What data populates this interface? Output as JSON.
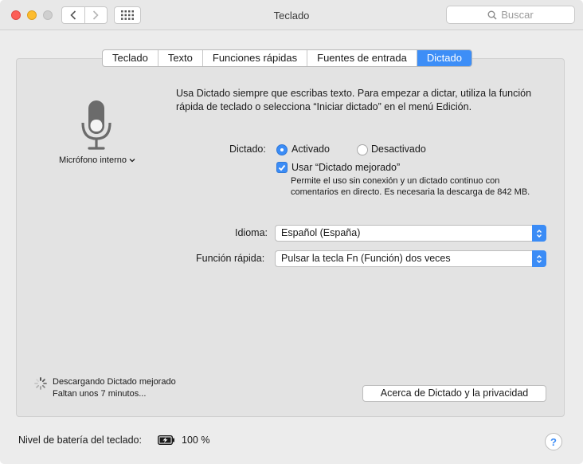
{
  "window": {
    "title": "Teclado",
    "search_placeholder": "Buscar"
  },
  "tabs": [
    {
      "label": "Teclado",
      "active": false
    },
    {
      "label": "Texto",
      "active": false
    },
    {
      "label": "Funciones rápidas",
      "active": false
    },
    {
      "label": "Fuentes de entrada",
      "active": false
    },
    {
      "label": "Dictado",
      "active": true
    }
  ],
  "mic": {
    "icon": "microphone-icon",
    "label": "Micrófono interno"
  },
  "dictation": {
    "intro": "Usa Dictado siempre que escribas texto. Para empezar a dictar, utiliza la función rápida de teclado o selecciona “Iniciar dictado” en el menú Edición.",
    "label": "Dictado:",
    "option_on": "Activado",
    "option_off": "Desactivado",
    "selected": "Activado",
    "enhanced_label": "Usar “Dictado mejorado”",
    "enhanced_checked": true,
    "enhanced_desc": "Permite el uso sin conexión y un dictado continuo con comentarios en directo. Es necesaria la descarga de 842 MB."
  },
  "language": {
    "label": "Idioma:",
    "value": "Español (España)"
  },
  "shortcut": {
    "label": "Función rápida:",
    "value": "Pulsar la tecla Fn (Función) dos veces"
  },
  "download": {
    "line1": "Descargando Dictado mejorado",
    "line2": "Faltan unos 7 minutos..."
  },
  "about_button": "Acerca de Dictado y la privacidad",
  "battery": {
    "label": "Nivel de batería del teclado:",
    "value": "100 %",
    "icon": "battery-charging-icon"
  },
  "colors": {
    "accent": "#3b8cf6",
    "close": "#fc5f57",
    "minimize": "#fdbc2e"
  }
}
